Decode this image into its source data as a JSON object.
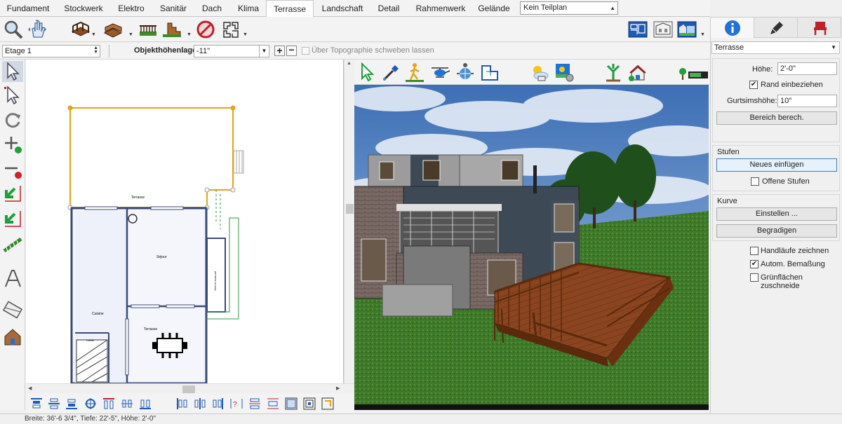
{
  "tabs": [
    "Fundament",
    "Stockwerk",
    "Elektro",
    "Sanitär",
    "Dach",
    "Klima",
    "Terrasse",
    "Landschaft",
    "Detail",
    "Rahmenwerk",
    "Gelände"
  ],
  "active_tab": "Terrasse",
  "plan_select": "Kein Teilplan",
  "options": {
    "etage": "Etage 1",
    "objekthoehe_label": "Objekthöhenlage:",
    "objekthoehe_value": "-11\"",
    "topo_label": "Über Topographie schweben lassen"
  },
  "plan_labels": {
    "terrasse_top": "Terrasse",
    "sejour": "Séjour",
    "cuisine": "Cuisine",
    "cellier": "Cellier",
    "terrasse_bottom": "Terrasse",
    "side": "Vers le sous-sol"
  },
  "status": "Breite: 36'-6 3/4\", Tiefe: 22'-5\", Höhe: 2'-0\"",
  "right_panel": {
    "select": "Terrasse",
    "hoehe_label": "Höhe:",
    "hoehe_value": "2'-0\"",
    "rand_label": "Rand einbeziehen",
    "gurt_label": "Gurtsimshöhe:",
    "gurt_value": "10\"",
    "bereich_btn": "Bereich berech.",
    "stufen_head": "Stufen",
    "neues_btn": "Neues einfügen",
    "offene_label": "Offene Stufen",
    "kurve_head": "Kurve",
    "einstellen_btn": "Einstellen ...",
    "begradigen_btn": "Begradigen",
    "handlaeufe_label": "Handläufe zeichnen",
    "bemassung_label": "Autom. Bemaßung",
    "gruen_label": "Grünflächen zuschneide"
  },
  "colors": {
    "selection": "#e6a317",
    "accent_blue": "#1e73d6",
    "deck": "#7a3b1a",
    "grass": "#3f7a2a"
  }
}
